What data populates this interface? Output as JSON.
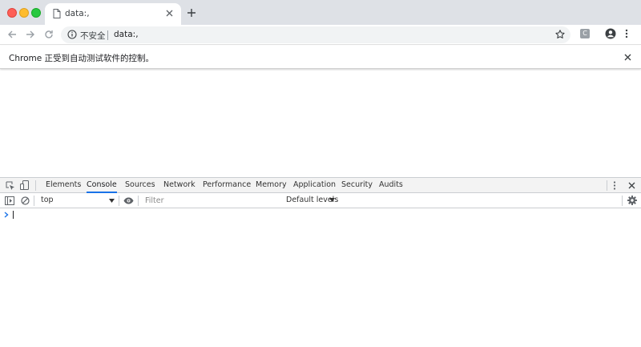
{
  "window": {
    "traffic_colors": {
      "close": "#fe5f57",
      "minimize": "#febc2e",
      "zoom": "#28c840"
    }
  },
  "tab": {
    "title": "data:,",
    "icon": "file-icon"
  },
  "toolbar": {
    "security_label": "不安全",
    "url": "data:,",
    "extension_label": "C"
  },
  "infobar": {
    "message": "Chrome 正受到自动测试软件的控制。"
  },
  "devtools": {
    "tabs": [
      {
        "label": "Elements",
        "active": false
      },
      {
        "label": "Console",
        "active": true
      },
      {
        "label": "Sources",
        "active": false
      },
      {
        "label": "Network",
        "active": false
      },
      {
        "label": "Performance",
        "active": false
      },
      {
        "label": "Memory",
        "active": false
      },
      {
        "label": "Application",
        "active": false
      },
      {
        "label": "Security",
        "active": false
      },
      {
        "label": "Audits",
        "active": false
      }
    ],
    "accent_color": "#1a73e8",
    "console": {
      "context": "top",
      "filter_placeholder": "Filter",
      "filter_value": "",
      "levels_label": "Default levels"
    }
  }
}
